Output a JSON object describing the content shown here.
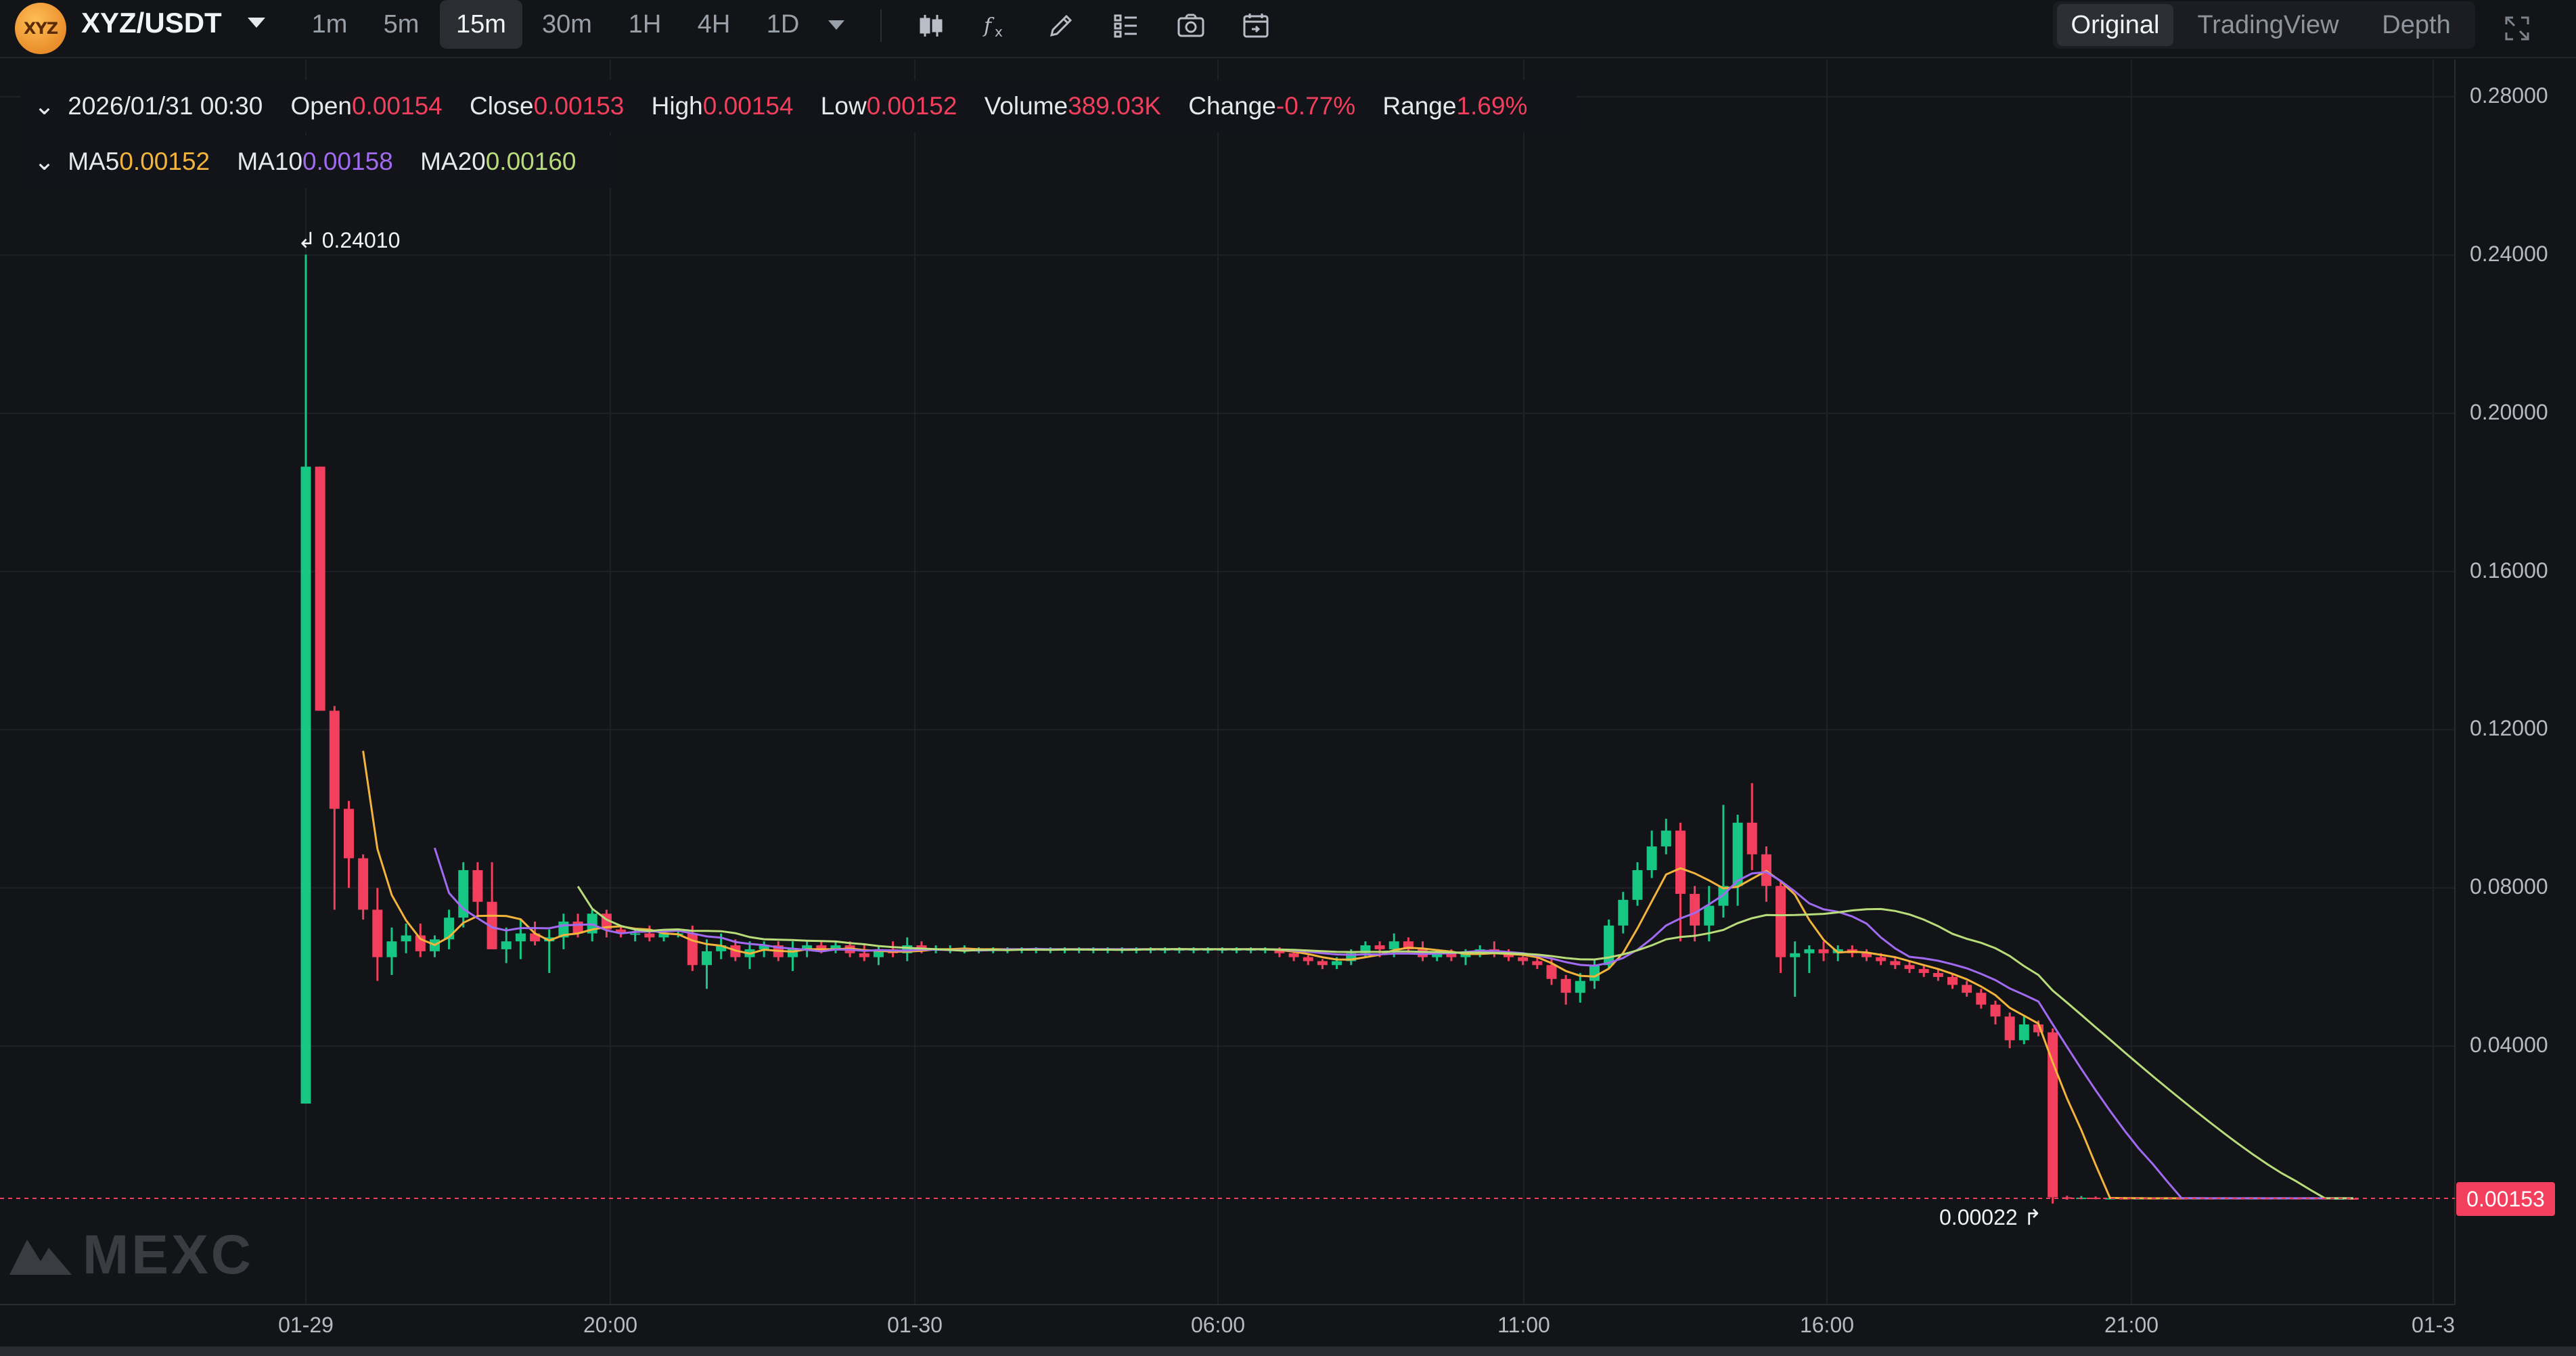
{
  "toolbar": {
    "logo_text": "XYZ",
    "pair": "XYZ/USDT",
    "timeframes": [
      "1m",
      "5m",
      "15m",
      "30m",
      "1H",
      "4H",
      "1D"
    ],
    "active_timeframe": "15m",
    "tools": [
      "candle-type-icon",
      "indicator-fx-icon",
      "drawing-pencil-icon",
      "layout-grid-icon",
      "camera-icon",
      "calendar-goto-icon"
    ],
    "view_tabs": [
      "Original",
      "TradingView",
      "Depth"
    ],
    "active_view": "Original"
  },
  "legend": {
    "datetime": "2026/01/31 00:30",
    "open_label": "Open",
    "open": "0.00154",
    "close_label": "Close",
    "close": "0.00153",
    "high_label": "High",
    "high": "0.00154",
    "low_label": "Low",
    "low": "0.00152",
    "volume_label": "Volume",
    "volume": "389.03K",
    "change_label": "Change",
    "change": "-0.77%",
    "range_label": "Range",
    "range": "1.69%",
    "ma5_label": "MA5",
    "ma5": "0.00152",
    "ma10_label": "MA10",
    "ma10": "0.00158",
    "ma20_label": "MA20",
    "ma20": "0.00160"
  },
  "annotations": {
    "max_price": "0.24010",
    "min_price": "0.00022",
    "last_price": "0.00153"
  },
  "watermark": "MEXC",
  "colors": {
    "up": "#16c784",
    "down": "#f23f5d",
    "ma5": "#f3b43c",
    "ma10": "#a06bf0",
    "ma20": "#b9dc7a",
    "background": "#131418",
    "grid": "#1f2126"
  },
  "chart_data": {
    "type": "candlestick",
    "interval": "15m",
    "y_axis": {
      "ticks": [
        "0.28000",
        "0.24000",
        "0.20000",
        "0.16000",
        "0.12000",
        "0.08000",
        "0.04000"
      ],
      "range": [
        0.0,
        0.29
      ]
    },
    "x_axis": {
      "ticks": [
        "01-29",
        "20:00",
        "01-30",
        "06:00",
        "11:00",
        "16:00",
        "21:00",
        "01-3"
      ]
    },
    "candles": [
      {
        "t": 0.0,
        "o": 0.0255,
        "h": 0.2401,
        "l": 0.0255,
        "c": 0.1865
      },
      {
        "t": 1,
        "o": 0.1865,
        "h": 0.1865,
        "l": 0.1248,
        "c": 0.1248
      },
      {
        "t": 2,
        "o": 0.1248,
        "h": 0.126,
        "l": 0.0745,
        "c": 0.1
      },
      {
        "t": 3,
        "o": 0.1,
        "h": 0.102,
        "l": 0.08,
        "c": 0.0875
      },
      {
        "t": 4,
        "o": 0.0875,
        "h": 0.0885,
        "l": 0.072,
        "c": 0.0745
      },
      {
        "t": 5,
        "o": 0.0745,
        "h": 0.08,
        "l": 0.0565,
        "c": 0.0625
      },
      {
        "t": 6,
        "o": 0.0625,
        "h": 0.07,
        "l": 0.058,
        "c": 0.0665
      },
      {
        "t": 7,
        "o": 0.0665,
        "h": 0.071,
        "l": 0.0635,
        "c": 0.068
      },
      {
        "t": 8,
        "o": 0.068,
        "h": 0.071,
        "l": 0.0625,
        "c": 0.064
      },
      {
        "t": 9,
        "o": 0.064,
        "h": 0.068,
        "l": 0.0625,
        "c": 0.067
      },
      {
        "t": 10,
        "o": 0.067,
        "h": 0.0745,
        "l": 0.0645,
        "c": 0.0725
      },
      {
        "t": 11,
        "o": 0.0725,
        "h": 0.0865,
        "l": 0.07,
        "c": 0.0845
      },
      {
        "t": 12,
        "o": 0.0845,
        "h": 0.0865,
        "l": 0.073,
        "c": 0.0765
      },
      {
        "t": 13,
        "o": 0.0765,
        "h": 0.0865,
        "l": 0.0645,
        "c": 0.0645
      },
      {
        "t": 14,
        "o": 0.0645,
        "h": 0.07,
        "l": 0.061,
        "c": 0.0665
      },
      {
        "t": 15,
        "o": 0.0665,
        "h": 0.072,
        "l": 0.062,
        "c": 0.0685
      },
      {
        "t": 16,
        "o": 0.0685,
        "h": 0.0715,
        "l": 0.0655,
        "c": 0.0665
      },
      {
        "t": 17,
        "o": 0.0665,
        "h": 0.0695,
        "l": 0.0585,
        "c": 0.0675
      },
      {
        "t": 18,
        "o": 0.0675,
        "h": 0.0735,
        "l": 0.0645,
        "c": 0.0715
      },
      {
        "t": 19,
        "o": 0.0715,
        "h": 0.0735,
        "l": 0.0675,
        "c": 0.0685
      },
      {
        "t": 20,
        "o": 0.0685,
        "h": 0.0745,
        "l": 0.0665,
        "c": 0.0735
      },
      {
        "t": 21,
        "o": 0.0735,
        "h": 0.0745,
        "l": 0.0675,
        "c": 0.0695
      },
      {
        "t": 22,
        "o": 0.0695,
        "h": 0.0705,
        "l": 0.0675,
        "c": 0.0685
      },
      {
        "t": 23,
        "o": 0.0685,
        "h": 0.0695,
        "l": 0.0665,
        "c": 0.0685
      },
      {
        "t": 24,
        "o": 0.0685,
        "h": 0.0705,
        "l": 0.0665,
        "c": 0.0675
      },
      {
        "t": 25,
        "o": 0.0675,
        "h": 0.0695,
        "l": 0.0665,
        "c": 0.0685
      },
      {
        "t": 26,
        "o": 0.0685,
        "h": 0.0695,
        "l": 0.0675,
        "c": 0.0685
      },
      {
        "t": 27,
        "o": 0.0685,
        "h": 0.0705,
        "l": 0.059,
        "c": 0.0605
      },
      {
        "t": 28,
        "o": 0.0605,
        "h": 0.067,
        "l": 0.0545,
        "c": 0.064
      },
      {
        "t": 29,
        "o": 0.064,
        "h": 0.0685,
        "l": 0.062,
        "c": 0.0655
      },
      {
        "t": 30,
        "o": 0.0655,
        "h": 0.067,
        "l": 0.0615,
        "c": 0.0625
      },
      {
        "t": 31,
        "o": 0.0625,
        "h": 0.0665,
        "l": 0.0595,
        "c": 0.0645
      },
      {
        "t": 32,
        "o": 0.0645,
        "h": 0.0665,
        "l": 0.0625,
        "c": 0.0655
      },
      {
        "t": 33,
        "o": 0.0655,
        "h": 0.0665,
        "l": 0.0615,
        "c": 0.0625
      },
      {
        "t": 34,
        "o": 0.0625,
        "h": 0.0665,
        "l": 0.059,
        "c": 0.0645
      },
      {
        "t": 35,
        "o": 0.0645,
        "h": 0.0665,
        "l": 0.0625,
        "c": 0.0655
      },
      {
        "t": 36,
        "o": 0.0655,
        "h": 0.0665,
        "l": 0.0635,
        "c": 0.0645
      },
      {
        "t": 37,
        "o": 0.0645,
        "h": 0.0665,
        "l": 0.0635,
        "c": 0.0655
      },
      {
        "t": 38,
        "o": 0.0655,
        "h": 0.0665,
        "l": 0.0625,
        "c": 0.0635
      },
      {
        "t": 39,
        "o": 0.0635,
        "h": 0.0655,
        "l": 0.0615,
        "c": 0.0625
      },
      {
        "t": 40,
        "o": 0.0625,
        "h": 0.0655,
        "l": 0.0605,
        "c": 0.0645
      },
      {
        "t": 41,
        "o": 0.0645,
        "h": 0.0665,
        "l": 0.0625,
        "c": 0.0635
      },
      {
        "t": 42,
        "o": 0.0635,
        "h": 0.0675,
        "l": 0.0615,
        "c": 0.0655
      },
      {
        "t": 43,
        "o": 0.0655,
        "h": 0.0665,
        "l": 0.0635,
        "c": 0.0645
      },
      {
        "t": 44,
        "o": 0.0645,
        "h": 0.0655,
        "l": 0.0635,
        "c": 0.0645
      },
      {
        "t": 45,
        "o": 0.0645,
        "h": 0.0655,
        "l": 0.0635,
        "c": 0.0645
      },
      {
        "t": 46,
        "o": 0.0645,
        "h": 0.0655,
        "l": 0.0635,
        "c": 0.0645
      },
      {
        "t": 47,
        "o": 0.0645,
        "h": 0.065,
        "l": 0.0635,
        "c": 0.0645
      },
      {
        "t": 48,
        "o": 0.0645,
        "h": 0.065,
        "l": 0.0635,
        "c": 0.0645
      },
      {
        "t": 49,
        "o": 0.0645,
        "h": 0.065,
        "l": 0.0635,
        "c": 0.0645
      },
      {
        "t": 50,
        "o": 0.0645,
        "h": 0.065,
        "l": 0.0635,
        "c": 0.0645
      },
      {
        "t": 51,
        "o": 0.0645,
        "h": 0.065,
        "l": 0.0635,
        "c": 0.0645
      },
      {
        "t": 52,
        "o": 0.0645,
        "h": 0.065,
        "l": 0.0635,
        "c": 0.0645
      },
      {
        "t": 53,
        "o": 0.0645,
        "h": 0.065,
        "l": 0.0635,
        "c": 0.0645
      },
      {
        "t": 54,
        "o": 0.0645,
        "h": 0.065,
        "l": 0.0635,
        "c": 0.0645
      },
      {
        "t": 55,
        "o": 0.0645,
        "h": 0.065,
        "l": 0.0635,
        "c": 0.0645
      },
      {
        "t": 56,
        "o": 0.0645,
        "h": 0.065,
        "l": 0.0635,
        "c": 0.0645
      },
      {
        "t": 57,
        "o": 0.0645,
        "h": 0.065,
        "l": 0.0635,
        "c": 0.0645
      },
      {
        "t": 58,
        "o": 0.0645,
        "h": 0.065,
        "l": 0.0635,
        "c": 0.0645
      },
      {
        "t": 59,
        "o": 0.0645,
        "h": 0.065,
        "l": 0.0635,
        "c": 0.0645
      },
      {
        "t": 60,
        "o": 0.0645,
        "h": 0.065,
        "l": 0.0635,
        "c": 0.0645
      },
      {
        "t": 61,
        "o": 0.0645,
        "h": 0.065,
        "l": 0.0635,
        "c": 0.0645
      },
      {
        "t": 62,
        "o": 0.0645,
        "h": 0.065,
        "l": 0.0635,
        "c": 0.0645
      },
      {
        "t": 63,
        "o": 0.0645,
        "h": 0.065,
        "l": 0.0635,
        "c": 0.0645
      },
      {
        "t": 64,
        "o": 0.0645,
        "h": 0.065,
        "l": 0.0635,
        "c": 0.0645
      },
      {
        "t": 65,
        "o": 0.0645,
        "h": 0.065,
        "l": 0.0635,
        "c": 0.0645
      },
      {
        "t": 66,
        "o": 0.0645,
        "h": 0.065,
        "l": 0.0635,
        "c": 0.0645
      },
      {
        "t": 67,
        "o": 0.0645,
        "h": 0.065,
        "l": 0.0635,
        "c": 0.0645
      },
      {
        "t": 68,
        "o": 0.0645,
        "h": 0.065,
        "l": 0.0625,
        "c": 0.0635
      },
      {
        "t": 69,
        "o": 0.0635,
        "h": 0.064,
        "l": 0.0615,
        "c": 0.0625
      },
      {
        "t": 70,
        "o": 0.0625,
        "h": 0.063,
        "l": 0.0605,
        "c": 0.0615
      },
      {
        "t": 71,
        "o": 0.0615,
        "h": 0.062,
        "l": 0.0595,
        "c": 0.0605
      },
      {
        "t": 72,
        "o": 0.0605,
        "h": 0.0625,
        "l": 0.0595,
        "c": 0.0615
      },
      {
        "t": 73,
        "o": 0.0615,
        "h": 0.0645,
        "l": 0.0605,
        "c": 0.0635
      },
      {
        "t": 74,
        "o": 0.0635,
        "h": 0.0665,
        "l": 0.0625,
        "c": 0.0655
      },
      {
        "t": 75,
        "o": 0.0655,
        "h": 0.0665,
        "l": 0.0625,
        "c": 0.0645
      },
      {
        "t": 76,
        "o": 0.0645,
        "h": 0.0685,
        "l": 0.0625,
        "c": 0.0665
      },
      {
        "t": 77,
        "o": 0.0665,
        "h": 0.0675,
        "l": 0.0635,
        "c": 0.0645
      },
      {
        "t": 78,
        "o": 0.0645,
        "h": 0.0665,
        "l": 0.0615,
        "c": 0.0625
      },
      {
        "t": 79,
        "o": 0.0625,
        "h": 0.0645,
        "l": 0.0615,
        "c": 0.0635
      },
      {
        "t": 80,
        "o": 0.0635,
        "h": 0.0645,
        "l": 0.0615,
        "c": 0.0625
      },
      {
        "t": 81,
        "o": 0.0625,
        "h": 0.0645,
        "l": 0.0605,
        "c": 0.0635
      },
      {
        "t": 82,
        "o": 0.0635,
        "h": 0.0655,
        "l": 0.0625,
        "c": 0.0645
      },
      {
        "t": 83,
        "o": 0.0645,
        "h": 0.0665,
        "l": 0.0625,
        "c": 0.0635
      },
      {
        "t": 84,
        "o": 0.0635,
        "h": 0.0645,
        "l": 0.0615,
        "c": 0.0625
      },
      {
        "t": 85,
        "o": 0.0625,
        "h": 0.0635,
        "l": 0.0605,
        "c": 0.0615
      },
      {
        "t": 86,
        "o": 0.0615,
        "h": 0.0625,
        "l": 0.0595,
        "c": 0.0605
      },
      {
        "t": 87,
        "o": 0.0605,
        "h": 0.062,
        "l": 0.0555,
        "c": 0.057
      },
      {
        "t": 88,
        "o": 0.057,
        "h": 0.058,
        "l": 0.0505,
        "c": 0.0535
      },
      {
        "t": 89,
        "o": 0.0535,
        "h": 0.0585,
        "l": 0.051,
        "c": 0.0565
      },
      {
        "t": 90,
        "o": 0.0565,
        "h": 0.062,
        "l": 0.0545,
        "c": 0.0605
      },
      {
        "t": 91,
        "o": 0.0605,
        "h": 0.072,
        "l": 0.0595,
        "c": 0.0705
      },
      {
        "t": 92,
        "o": 0.0705,
        "h": 0.079,
        "l": 0.0685,
        "c": 0.077
      },
      {
        "t": 93,
        "o": 0.077,
        "h": 0.0865,
        "l": 0.0755,
        "c": 0.0845
      },
      {
        "t": 94,
        "o": 0.0845,
        "h": 0.0945,
        "l": 0.0825,
        "c": 0.0905
      },
      {
        "t": 95,
        "o": 0.0905,
        "h": 0.0975,
        "l": 0.0885,
        "c": 0.0945
      },
      {
        "t": 96,
        "o": 0.0945,
        "h": 0.0965,
        "l": 0.0665,
        "c": 0.0785
      },
      {
        "t": 97,
        "o": 0.0785,
        "h": 0.0805,
        "l": 0.0665,
        "c": 0.0705
      },
      {
        "t": 98,
        "o": 0.0705,
        "h": 0.0805,
        "l": 0.0665,
        "c": 0.0755
      },
      {
        "t": 99,
        "o": 0.0755,
        "h": 0.101,
        "l": 0.0725,
        "c": 0.0805
      },
      {
        "t": 100,
        "o": 0.0805,
        "h": 0.0985,
        "l": 0.0755,
        "c": 0.0965
      },
      {
        "t": 101,
        "o": 0.0965,
        "h": 0.1065,
        "l": 0.0845,
        "c": 0.0885
      },
      {
        "t": 102,
        "o": 0.0885,
        "h": 0.0905,
        "l": 0.0765,
        "c": 0.0805
      },
      {
        "t": 103,
        "o": 0.0805,
        "h": 0.0815,
        "l": 0.0585,
        "c": 0.0625
      },
      {
        "t": 104,
        "o": 0.0625,
        "h": 0.0665,
        "l": 0.0525,
        "c": 0.0635
      },
      {
        "t": 105,
        "o": 0.0635,
        "h": 0.0655,
        "l": 0.0585,
        "c": 0.0645
      },
      {
        "t": 106,
        "o": 0.0645,
        "h": 0.0665,
        "l": 0.0615,
        "c": 0.0635
      },
      {
        "t": 107,
        "o": 0.0635,
        "h": 0.0655,
        "l": 0.0615,
        "c": 0.0645
      },
      {
        "t": 108,
        "o": 0.0645,
        "h": 0.0655,
        "l": 0.0625,
        "c": 0.0635
      },
      {
        "t": 109,
        "o": 0.0635,
        "h": 0.0645,
        "l": 0.0615,
        "c": 0.0625
      },
      {
        "t": 110,
        "o": 0.0625,
        "h": 0.0635,
        "l": 0.0605,
        "c": 0.0615
      },
      {
        "t": 111,
        "o": 0.0615,
        "h": 0.0625,
        "l": 0.0595,
        "c": 0.0605
      },
      {
        "t": 112,
        "o": 0.0605,
        "h": 0.0615,
        "l": 0.0585,
        "c": 0.0595
      },
      {
        "t": 113,
        "o": 0.0595,
        "h": 0.0605,
        "l": 0.0575,
        "c": 0.0585
      },
      {
        "t": 114,
        "o": 0.0585,
        "h": 0.0595,
        "l": 0.0565,
        "c": 0.0575
      },
      {
        "t": 115,
        "o": 0.0575,
        "h": 0.0585,
        "l": 0.0545,
        "c": 0.0555
      },
      {
        "t": 116,
        "o": 0.0555,
        "h": 0.0565,
        "l": 0.0525,
        "c": 0.0535
      },
      {
        "t": 117,
        "o": 0.0535,
        "h": 0.0545,
        "l": 0.0495,
        "c": 0.0505
      },
      {
        "t": 118,
        "o": 0.0505,
        "h": 0.0515,
        "l": 0.0455,
        "c": 0.0475
      },
      {
        "t": 119,
        "o": 0.0475,
        "h": 0.0485,
        "l": 0.0395,
        "c": 0.0415
      },
      {
        "t": 120,
        "o": 0.0415,
        "h": 0.0475,
        "l": 0.0405,
        "c": 0.0455
      },
      {
        "t": 121,
        "o": 0.0455,
        "h": 0.0465,
        "l": 0.0425,
        "c": 0.0435
      },
      {
        "t": 122,
        "o": 0.0435,
        "h": 0.0445,
        "l": 0.00022,
        "c": 0.0018
      },
      {
        "t": 123,
        "o": 0.0018,
        "h": 0.0022,
        "l": 0.0012,
        "c": 0.0016
      },
      {
        "t": 124,
        "o": 0.0016,
        "h": 0.0021,
        "l": 0.0013,
        "c": 0.0017
      },
      {
        "t": 125,
        "o": 0.0017,
        "h": 0.002,
        "l": 0.0013,
        "c": 0.0015
      },
      {
        "t": 126,
        "o": 0.0015,
        "h": 0.0019,
        "l": 0.0013,
        "c": 0.0016
      },
      {
        "t": 127,
        "o": 0.0016,
        "h": 0.0019,
        "l": 0.0013,
        "c": 0.0015
      },
      {
        "t": 128,
        "o": 0.0015,
        "h": 0.0018,
        "l": 0.0013,
        "c": 0.0016
      },
      {
        "t": 129,
        "o": 0.0016,
        "h": 0.0018,
        "l": 0.0013,
        "c": 0.0015
      },
      {
        "t": 130,
        "o": 0.0015,
        "h": 0.0018,
        "l": 0.0013,
        "c": 0.0016
      },
      {
        "t": 131,
        "o": 0.0016,
        "h": 0.0018,
        "l": 0.0013,
        "c": 0.0015
      },
      {
        "t": 132,
        "o": 0.0015,
        "h": 0.0017,
        "l": 0.0013,
        "c": 0.0016
      },
      {
        "t": 133,
        "o": 0.0016,
        "h": 0.0017,
        "l": 0.0014,
        "c": 0.0015
      },
      {
        "t": 134,
        "o": 0.0015,
        "h": 0.0017,
        "l": 0.0014,
        "c": 0.0016
      },
      {
        "t": 135,
        "o": 0.0016,
        "h": 0.0017,
        "l": 0.0014,
        "c": 0.0015
      },
      {
        "t": 136,
        "o": 0.0015,
        "h": 0.0017,
        "l": 0.0014,
        "c": 0.0016
      },
      {
        "t": 137,
        "o": 0.0016,
        "h": 0.0017,
        "l": 0.0014,
        "c": 0.0015
      },
      {
        "t": 138,
        "o": 0.0015,
        "h": 0.0017,
        "l": 0.0014,
        "c": 0.0016
      },
      {
        "t": 139,
        "o": 0.0016,
        "h": 0.0017,
        "l": 0.0014,
        "c": 0.0015
      },
      {
        "t": 140,
        "o": 0.0015,
        "h": 0.0017,
        "l": 0.0014,
        "c": 0.0016
      },
      {
        "t": 141,
        "o": 0.0016,
        "h": 0.0017,
        "l": 0.0014,
        "c": 0.0015
      },
      {
        "t": 142,
        "o": 0.0015,
        "h": 0.0016,
        "l": 0.0014,
        "c": 0.00154
      },
      {
        "t": 143,
        "o": 0.00154,
        "h": 0.00154,
        "l": 0.00152,
        "c": 0.00153
      }
    ],
    "moving_averages": [
      "MA5",
      "MA10",
      "MA20"
    ]
  }
}
